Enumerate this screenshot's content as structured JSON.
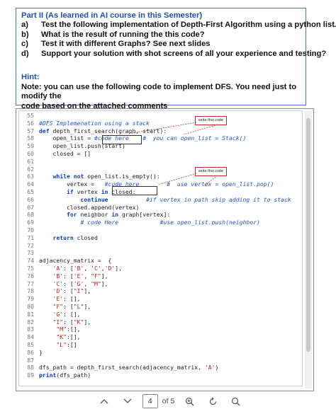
{
  "task": {
    "title": "Part II (As learned in AI course in this Semester)",
    "items": [
      {
        "letter": "a)",
        "text": "Test the following implementation of  Depth-First Algorithm using a python list."
      },
      {
        "letter": "b)",
        "text": "What is the result of running the this code?"
      },
      {
        "letter": "c)",
        "text": "Test it with different Graphs? See next slides"
      },
      {
        "letter": "d)",
        "text": "Support your solution with shot screens of all your experience and testing?"
      }
    ],
    "hint_title": "Hint:",
    "note_line1": "Note: you can use the following code to implement DFS. You need just to modify the",
    "note_line2": "code based on the attached comments"
  },
  "code": {
    "lines": [
      {
        "n": "55",
        "segs": []
      },
      {
        "n": "56",
        "segs": [
          {
            "c": "cm",
            "t": "#DFS Implemenation using a stack"
          }
        ]
      },
      {
        "n": "57",
        "segs": [
          {
            "c": "kw",
            "t": "def "
          },
          {
            "c": "pl",
            "t": "depth_first_search(graph, start):"
          }
        ]
      },
      {
        "n": "58",
        "segs": [
          {
            "c": "pl",
            "t": "    open_list = "
          },
          {
            "c": "cm",
            "t": "#code here    #  you can open_list = Stack()"
          }
        ]
      },
      {
        "n": "59",
        "segs": [
          {
            "c": "pl",
            "t": "    open_list.push(start)"
          }
        ]
      },
      {
        "n": "60",
        "segs": [
          {
            "c": "pl",
            "t": "    closed = []"
          }
        ]
      },
      {
        "n": "61",
        "segs": []
      },
      {
        "n": "62",
        "segs": []
      },
      {
        "n": "63",
        "segs": [
          {
            "c": "kw",
            "t": "    while not "
          },
          {
            "c": "pl",
            "t": "open_list.is_empty():"
          }
        ]
      },
      {
        "n": "64",
        "segs": [
          {
            "c": "pl",
            "t": "        vertex =   "
          },
          {
            "c": "cm",
            "t": "#code here        #  use vertex = open_list.pop()"
          }
        ]
      },
      {
        "n": "65",
        "segs": [
          {
            "c": "kw",
            "t": "        if "
          },
          {
            "c": "pl",
            "t": "vertex "
          },
          {
            "c": "kw",
            "t": "in "
          },
          {
            "c": "pl",
            "t": "closed:"
          }
        ]
      },
      {
        "n": "66",
        "segs": [
          {
            "c": "kw",
            "t": "            continue           "
          },
          {
            "c": "cm",
            "t": "#if vertex in path skip adding it to stack"
          }
        ]
      },
      {
        "n": "67",
        "segs": [
          {
            "c": "pl",
            "t": "        closed.append(vertex)"
          }
        ]
      },
      {
        "n": "68",
        "segs": [
          {
            "c": "kw",
            "t": "        for "
          },
          {
            "c": "pl",
            "t": "neighbor "
          },
          {
            "c": "kw",
            "t": "in "
          },
          {
            "c": "pl",
            "t": "graph[vertex]:"
          }
        ]
      },
      {
        "n": "69",
        "segs": [
          {
            "c": "cm",
            "t": "            # code Here            #use open_list.push(neighbor)"
          }
        ]
      },
      {
        "n": "70",
        "segs": []
      },
      {
        "n": "71",
        "segs": [
          {
            "c": "kw",
            "t": "    return "
          },
          {
            "c": "pl",
            "t": "closed"
          }
        ]
      },
      {
        "n": "72",
        "segs": []
      },
      {
        "n": "73",
        "segs": []
      },
      {
        "n": "74",
        "segs": [
          {
            "c": "pl",
            "t": "adjacency_matrix =  {"
          }
        ]
      },
      {
        "n": "75",
        "segs": [
          {
            "c": "st",
            "t": "    'A'"
          },
          {
            "c": "pl",
            "t": ": ["
          },
          {
            "c": "st",
            "t": "'B'"
          },
          {
            "c": "pl",
            "t": ", "
          },
          {
            "c": "st",
            "t": "'C'"
          },
          {
            "c": "pl",
            "t": ","
          },
          {
            "c": "st",
            "t": "'D'"
          },
          {
            "c": "pl",
            "t": "],"
          }
        ]
      },
      {
        "n": "76",
        "segs": [
          {
            "c": "st",
            "t": "    'B'"
          },
          {
            "c": "pl",
            "t": ": ["
          },
          {
            "c": "st",
            "t": "'E'"
          },
          {
            "c": "pl",
            "t": ", "
          },
          {
            "c": "st",
            "t": "\"F\""
          },
          {
            "c": "pl",
            "t": "],"
          }
        ]
      },
      {
        "n": "77",
        "segs": [
          {
            "c": "st",
            "t": "    'C'"
          },
          {
            "c": "pl",
            "t": ": ["
          },
          {
            "c": "st",
            "t": "'G'"
          },
          {
            "c": "pl",
            "t": ", "
          },
          {
            "c": "st",
            "t": "\"M\""
          },
          {
            "c": "pl",
            "t": "],"
          }
        ]
      },
      {
        "n": "78",
        "segs": [
          {
            "c": "st",
            "t": "    'D'"
          },
          {
            "c": "pl",
            "t": ": ["
          },
          {
            "c": "st",
            "t": "\"I\""
          },
          {
            "c": "pl",
            "t": "],"
          }
        ]
      },
      {
        "n": "79",
        "segs": [
          {
            "c": "st",
            "t": "    'E'"
          },
          {
            "c": "pl",
            "t": ": [],"
          }
        ]
      },
      {
        "n": "80",
        "segs": [
          {
            "c": "st",
            "t": "    \"F\""
          },
          {
            "c": "pl",
            "t": ": ["
          },
          {
            "c": "st",
            "t": "\"L\""
          },
          {
            "c": "pl",
            "t": "],"
          }
        ]
      },
      {
        "n": "81",
        "segs": [
          {
            "c": "st",
            "t": "    'G'"
          },
          {
            "c": "pl",
            "t": ": [],"
          }
        ]
      },
      {
        "n": "82",
        "segs": [
          {
            "c": "st",
            "t": "    \"I\""
          },
          {
            "c": "pl",
            "t": ": ["
          },
          {
            "c": "st",
            "t": "\"K\""
          },
          {
            "c": "pl",
            "t": "],"
          }
        ]
      },
      {
        "n": "83",
        "segs": [
          {
            "c": "st",
            "t": "     \"M\""
          },
          {
            "c": "pl",
            "t": ":[],"
          }
        ]
      },
      {
        "n": "84",
        "segs": [
          {
            "c": "st",
            "t": "     \"K\""
          },
          {
            "c": "pl",
            "t": ":[],"
          }
        ]
      },
      {
        "n": "85",
        "segs": [
          {
            "c": "st",
            "t": "     \"L\""
          },
          {
            "c": "pl",
            "t": ":[]"
          }
        ]
      },
      {
        "n": "86",
        "segs": [
          {
            "c": "pl",
            "t": "}"
          }
        ]
      },
      {
        "n": "87",
        "segs": []
      },
      {
        "n": "88",
        "segs": [
          {
            "c": "pl",
            "t": "dfs_path = depth_first_search(adjacency_matrix, "
          },
          {
            "c": "st",
            "t": "'A'"
          },
          {
            "c": "pl",
            "t": ")"
          }
        ]
      },
      {
        "n": "89",
        "segs": [
          {
            "c": "kw",
            "t": "print"
          },
          {
            "c": "pl",
            "t": "(dfs_path)"
          }
        ]
      }
    ],
    "callout1": "write this code",
    "callout2": "write this code"
  },
  "toolbar": {
    "page_current": "4",
    "page_total_label": "of 5",
    "icons": [
      "chevron-up-icon",
      "chevron-down-icon",
      "zoom-in-icon",
      "rotate-icon",
      "search-icon"
    ]
  },
  "colors": {
    "keyword": "#0b3fb5",
    "comment": "#2155c8",
    "string": "#b41e1e",
    "border": "#4a72c4",
    "callout": "#c02828"
  }
}
